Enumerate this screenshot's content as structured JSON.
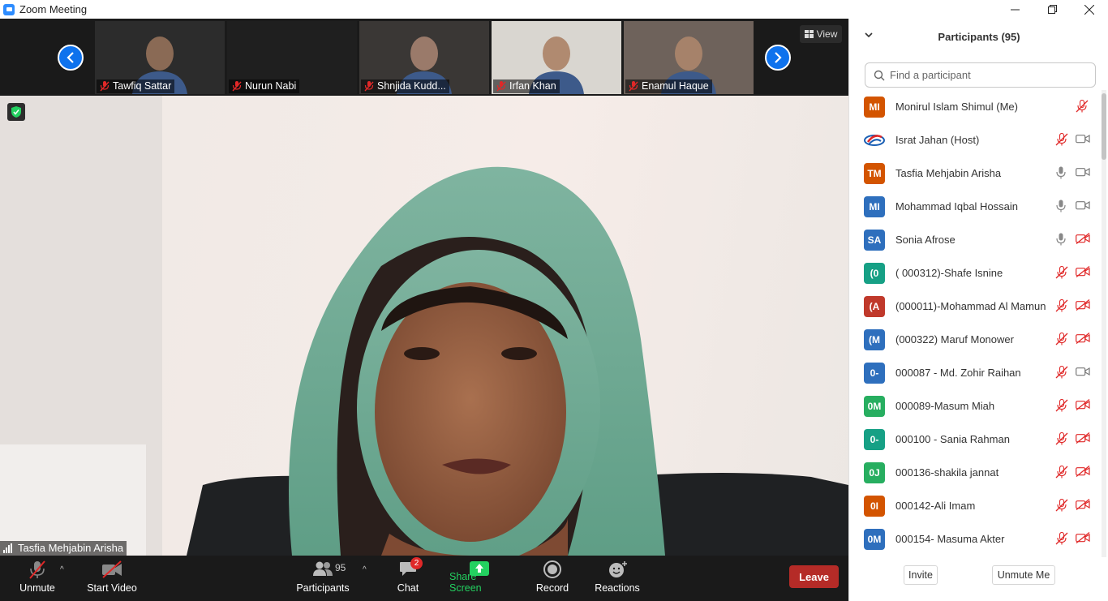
{
  "window": {
    "title": "Zoom Meeting"
  },
  "strip": {
    "view_label": "View",
    "thumbnails": [
      {
        "name": "Tawfiq Sattar",
        "bg": "#2c2c2c",
        "face": "#8a6a55"
      },
      {
        "name": "Nurun Nabi",
        "bg": "#1f1f1f",
        "face": ""
      },
      {
        "name": "Shnjida Kudd...",
        "bg": "#3a3735",
        "face": "#9a7a6a"
      },
      {
        "name": "Irfan Khan",
        "bg": "#d9d6d0",
        "face": "#b08a70"
      },
      {
        "name": "Enamul Haque",
        "bg": "#6e625b",
        "face": "#a6826a"
      }
    ]
  },
  "main_video": {
    "speaker_name": "Tasfia Mehjabin Arisha"
  },
  "toolbar": {
    "unmute": "Unmute",
    "start_video": "Start Video",
    "participants": "Participants",
    "participants_count": "95",
    "chat": "Chat",
    "chat_badge": "2",
    "share_screen": "Share Screen",
    "record": "Record",
    "reactions": "Reactions",
    "leave": "Leave"
  },
  "panel": {
    "title": "Participants (95)",
    "search_placeholder": "Find a participant",
    "invite": "Invite",
    "unmute_me": "Unmute Me",
    "participants": [
      {
        "initials": "MI",
        "name": "Monirul Islam Shimul (Me)",
        "color": "#d35400",
        "mic": "off",
        "cam": ""
      },
      {
        "initials": "",
        "name": "Israt Jahan (Host)",
        "color": "logo",
        "mic": "off",
        "cam": "on"
      },
      {
        "initials": "TM",
        "name": "Tasfia Mehjabin Arisha",
        "color": "#d35400",
        "mic": "on",
        "cam": "on"
      },
      {
        "initials": "MI",
        "name": "Mohammad Iqbal Hossain",
        "color": "#2e6fbd",
        "mic": "on",
        "cam": "on"
      },
      {
        "initials": "SA",
        "name": "Sonia Afrose",
        "color": "#2e6fbd",
        "mic": "on",
        "cam": "off"
      },
      {
        "initials": "(0",
        "name": "( 000312)-Shafe Isnine",
        "color": "#16a085",
        "mic": "off",
        "cam": "off"
      },
      {
        "initials": "(A",
        "name": "(000011)-Mohammad Al Mamun",
        "color": "#c0392b",
        "mic": "off",
        "cam": "off"
      },
      {
        "initials": "(M",
        "name": "(000322) Maruf Monower",
        "color": "#2e6fbd",
        "mic": "off",
        "cam": "off"
      },
      {
        "initials": "0-",
        "name": "000087 - Md. Zohir Raihan",
        "color": "#2e6fbd",
        "mic": "off",
        "cam": "on"
      },
      {
        "initials": "0M",
        "name": "000089-Masum Miah",
        "color": "#27ae60",
        "mic": "off",
        "cam": "off"
      },
      {
        "initials": "0-",
        "name": "000100 - Sania Rahman",
        "color": "#16a085",
        "mic": "off",
        "cam": "off"
      },
      {
        "initials": "0J",
        "name": "000136-shakila jannat",
        "color": "#27ae60",
        "mic": "off",
        "cam": "off"
      },
      {
        "initials": "0I",
        "name": "000142-Ali Imam",
        "color": "#d35400",
        "mic": "off",
        "cam": "off"
      },
      {
        "initials": "0M",
        "name": "000154- Masuma Akter",
        "color": "#2e6fbd",
        "mic": "off",
        "cam": "off"
      }
    ]
  }
}
